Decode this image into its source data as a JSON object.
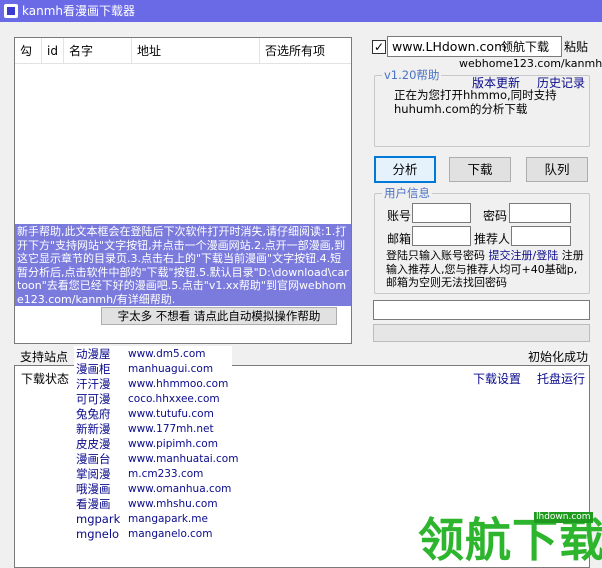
{
  "window": {
    "title": "kanmh看漫画下载器"
  },
  "list_header": {
    "col_check": "勾",
    "col_id": "id",
    "col_name": "名字",
    "col_addr": "地址",
    "col_select_all": "否选所有项"
  },
  "help_text": "新手帮助,此文本框会在登陆后下次软件打开时消失,请仔细阅读:1.打开下方\"支持网站\"文字按钮,并点击一个漫画网站.2.点开一部漫画,到这它显示章节的目录页.3.点击右上的\"下载当前漫画\"文字按钮.4.短暂分析后,点击软件中部的\"下载\"按钮.5.默认目录\"D:\\download\\cartoon\"去看您已经下好的漫画吧.5.点击\"v1.xx帮助\"到官网webhome123.com/kanmh/有详细帮助.",
  "lazy_button": "字太多 不想看 请点此自动模拟操作帮助",
  "url_bar": {
    "checked": "✓",
    "value": "www.LHdown.com",
    "nav_download": "领航下载",
    "paste": "粘贴",
    "site_url": "webhome123.com/kanmh"
  },
  "help_group": {
    "title": "v1.20帮助",
    "version_update": "版本更新",
    "history": "历史记录",
    "status": "正在为您打开hhmmo,同时支持huhumh.com的分析下载"
  },
  "actions": {
    "analyze": "分析",
    "download": "下载",
    "queue": "队列"
  },
  "user_group": {
    "title": "用户信息",
    "account_label": "账号",
    "password_label": "密码",
    "email_label": "邮箱",
    "referrer_label": "推荐人",
    "note_prefix": "登陆只输入账号密码",
    "submit_link": "提交注册/登陆",
    "note_rest": "注册输入推荐人,您与推荐人均可+40基础p,邮箱为空则无法找回密码"
  },
  "status_bar": {
    "support_sites": "支持站点",
    "init_status": "初始化成功"
  },
  "bottom_list": {
    "download_status": "下载状态",
    "download_settings": "下载设置",
    "tray_run": "托盘运行"
  },
  "sites": [
    {
      "name": "动漫屋",
      "url": "www.dm5.com"
    },
    {
      "name": "漫画柜",
      "url": "manhuagui.com"
    },
    {
      "name": "汗汗漫",
      "url": "www.hhmmoo.com"
    },
    {
      "name": "可可漫",
      "url": "coco.hhxxee.com"
    },
    {
      "name": "兔兔府",
      "url": "www.tutufu.com"
    },
    {
      "name": "新新漫",
      "url": "www.177mh.net"
    },
    {
      "name": "皮皮漫",
      "url": "www.pipimh.com"
    },
    {
      "name": "漫画台",
      "url": "www.manhuatai.com"
    },
    {
      "name": "掌阅漫",
      "url": "m.cm233.com"
    },
    {
      "name": "哦漫画",
      "url": "www.omanhua.com"
    },
    {
      "name": "看漫画",
      "url": "www.mhshu.com"
    },
    {
      "name": "mgpark",
      "url": "mangapark.me"
    },
    {
      "name": "mgnelo",
      "url": "manganelo.com"
    }
  ],
  "watermark": {
    "text": "领航下载",
    "domain": "lhdown.com"
  }
}
